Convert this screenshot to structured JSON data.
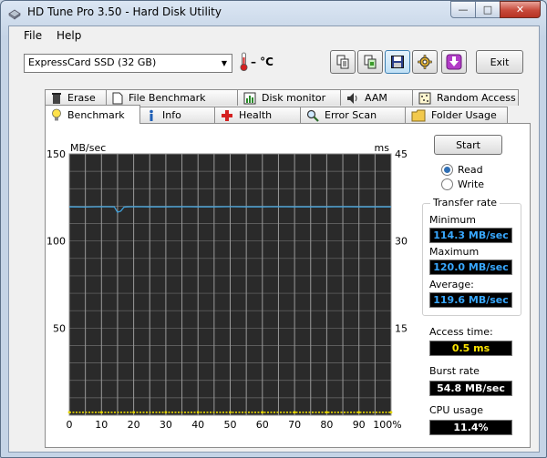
{
  "window": {
    "title": "HD Tune Pro 3.50 - Hard Disk Utility"
  },
  "menu": {
    "file": "File",
    "help": "Help"
  },
  "toolbar": {
    "drive": "ExpressCard SSD (32 GB)",
    "temperature": "– °C",
    "exit_label": "Exit"
  },
  "tabs_top": [
    "Erase",
    "File Benchmark",
    "Disk monitor",
    "AAM",
    "Random Access"
  ],
  "tabs_bottom": [
    "Benchmark",
    "Info",
    "Health",
    "Error Scan",
    "Folder Usage"
  ],
  "active_tab": "Benchmark",
  "controls": {
    "start_label": "Start",
    "read_label": "Read",
    "write_label": "Write",
    "selected_mode": "Read"
  },
  "transfer_rate": {
    "title": "Transfer rate",
    "minimum_label": "Minimum",
    "minimum": "114.3 MB/sec",
    "maximum_label": "Maximum",
    "maximum": "120.0 MB/sec",
    "average_label": "Average:",
    "average": "119.6 MB/sec"
  },
  "access_time": {
    "label": "Access time:",
    "value": "0.5 ms"
  },
  "burst_rate": {
    "label": "Burst rate",
    "value": "54.8 MB/sec"
  },
  "cpu_usage": {
    "label": "CPU usage",
    "value": "11.4%"
  },
  "colors": {
    "read_line": "#3f9fd8",
    "access_points": "#e6d600",
    "chart_bg": "#2a2a2a",
    "grid": "#9a9a9a",
    "value_blue": "#38a8ff",
    "value_yellow": "#ffe600"
  },
  "chart_data": {
    "type": "line",
    "ylabel": "MB/sec",
    "y2label": "ms",
    "ylim": [
      0,
      150
    ],
    "y2lim": [
      0,
      45
    ],
    "yticks": [
      50,
      100,
      150
    ],
    "y2ticks": [
      15,
      30,
      45
    ],
    "xlim": [
      0,
      100
    ],
    "xticks": [
      "0",
      "10",
      "20",
      "30",
      "40",
      "50",
      "60",
      "70",
      "80",
      "90",
      "100%"
    ],
    "grid": true,
    "series": [
      {
        "x": [
          0,
          5,
          10,
          14,
          15,
          16,
          17,
          18,
          20,
          25,
          30,
          35,
          40,
          45,
          50,
          55,
          60,
          65,
          70,
          75,
          80,
          85,
          90,
          95,
          100
        ],
        "values": [
          119.6,
          119.5,
          119.7,
          119.6,
          116.5,
          117.2,
          119.4,
          119.6,
          119.7,
          119.6,
          119.6,
          119.7,
          119.6,
          119.6,
          119.7,
          119.6,
          119.6,
          119.7,
          119.6,
          119.6,
          119.6,
          119.7,
          119.6,
          119.6,
          119.6
        ]
      },
      {
        "x": [
          0,
          10,
          20,
          30,
          40,
          50,
          60,
          70,
          80,
          90,
          100
        ],
        "values": [
          0.5,
          0.5,
          0.5,
          0.5,
          0.5,
          0.5,
          0.5,
          0.5,
          0.5,
          0.5,
          0.5
        ]
      }
    ]
  }
}
